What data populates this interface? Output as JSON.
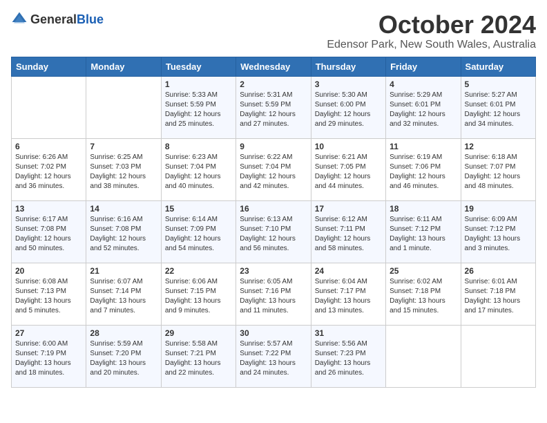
{
  "logo": {
    "general": "General",
    "blue": "Blue"
  },
  "header": {
    "month": "October 2024",
    "location": "Edensor Park, New South Wales, Australia"
  },
  "days_of_week": [
    "Sunday",
    "Monday",
    "Tuesday",
    "Wednesday",
    "Thursday",
    "Friday",
    "Saturday"
  ],
  "weeks": [
    [
      {
        "day": null
      },
      {
        "day": null
      },
      {
        "day": "1",
        "sunrise": "Sunrise: 5:33 AM",
        "sunset": "Sunset: 5:59 PM",
        "daylight": "Daylight: 12 hours and 25 minutes."
      },
      {
        "day": "2",
        "sunrise": "Sunrise: 5:31 AM",
        "sunset": "Sunset: 5:59 PM",
        "daylight": "Daylight: 12 hours and 27 minutes."
      },
      {
        "day": "3",
        "sunrise": "Sunrise: 5:30 AM",
        "sunset": "Sunset: 6:00 PM",
        "daylight": "Daylight: 12 hours and 29 minutes."
      },
      {
        "day": "4",
        "sunrise": "Sunrise: 5:29 AM",
        "sunset": "Sunset: 6:01 PM",
        "daylight": "Daylight: 12 hours and 32 minutes."
      },
      {
        "day": "5",
        "sunrise": "Sunrise: 5:27 AM",
        "sunset": "Sunset: 6:01 PM",
        "daylight": "Daylight: 12 hours and 34 minutes."
      }
    ],
    [
      {
        "day": "6",
        "sunrise": "Sunrise: 6:26 AM",
        "sunset": "Sunset: 7:02 PM",
        "daylight": "Daylight: 12 hours and 36 minutes."
      },
      {
        "day": "7",
        "sunrise": "Sunrise: 6:25 AM",
        "sunset": "Sunset: 7:03 PM",
        "daylight": "Daylight: 12 hours and 38 minutes."
      },
      {
        "day": "8",
        "sunrise": "Sunrise: 6:23 AM",
        "sunset": "Sunset: 7:04 PM",
        "daylight": "Daylight: 12 hours and 40 minutes."
      },
      {
        "day": "9",
        "sunrise": "Sunrise: 6:22 AM",
        "sunset": "Sunset: 7:04 PM",
        "daylight": "Daylight: 12 hours and 42 minutes."
      },
      {
        "day": "10",
        "sunrise": "Sunrise: 6:21 AM",
        "sunset": "Sunset: 7:05 PM",
        "daylight": "Daylight: 12 hours and 44 minutes."
      },
      {
        "day": "11",
        "sunrise": "Sunrise: 6:19 AM",
        "sunset": "Sunset: 7:06 PM",
        "daylight": "Daylight: 12 hours and 46 minutes."
      },
      {
        "day": "12",
        "sunrise": "Sunrise: 6:18 AM",
        "sunset": "Sunset: 7:07 PM",
        "daylight": "Daylight: 12 hours and 48 minutes."
      }
    ],
    [
      {
        "day": "13",
        "sunrise": "Sunrise: 6:17 AM",
        "sunset": "Sunset: 7:08 PM",
        "daylight": "Daylight: 12 hours and 50 minutes."
      },
      {
        "day": "14",
        "sunrise": "Sunrise: 6:16 AM",
        "sunset": "Sunset: 7:08 PM",
        "daylight": "Daylight: 12 hours and 52 minutes."
      },
      {
        "day": "15",
        "sunrise": "Sunrise: 6:14 AM",
        "sunset": "Sunset: 7:09 PM",
        "daylight": "Daylight: 12 hours and 54 minutes."
      },
      {
        "day": "16",
        "sunrise": "Sunrise: 6:13 AM",
        "sunset": "Sunset: 7:10 PM",
        "daylight": "Daylight: 12 hours and 56 minutes."
      },
      {
        "day": "17",
        "sunrise": "Sunrise: 6:12 AM",
        "sunset": "Sunset: 7:11 PM",
        "daylight": "Daylight: 12 hours and 58 minutes."
      },
      {
        "day": "18",
        "sunrise": "Sunrise: 6:11 AM",
        "sunset": "Sunset: 7:12 PM",
        "daylight": "Daylight: 13 hours and 1 minute."
      },
      {
        "day": "19",
        "sunrise": "Sunrise: 6:09 AM",
        "sunset": "Sunset: 7:12 PM",
        "daylight": "Daylight: 13 hours and 3 minutes."
      }
    ],
    [
      {
        "day": "20",
        "sunrise": "Sunrise: 6:08 AM",
        "sunset": "Sunset: 7:13 PM",
        "daylight": "Daylight: 13 hours and 5 minutes."
      },
      {
        "day": "21",
        "sunrise": "Sunrise: 6:07 AM",
        "sunset": "Sunset: 7:14 PM",
        "daylight": "Daylight: 13 hours and 7 minutes."
      },
      {
        "day": "22",
        "sunrise": "Sunrise: 6:06 AM",
        "sunset": "Sunset: 7:15 PM",
        "daylight": "Daylight: 13 hours and 9 minutes."
      },
      {
        "day": "23",
        "sunrise": "Sunrise: 6:05 AM",
        "sunset": "Sunset: 7:16 PM",
        "daylight": "Daylight: 13 hours and 11 minutes."
      },
      {
        "day": "24",
        "sunrise": "Sunrise: 6:04 AM",
        "sunset": "Sunset: 7:17 PM",
        "daylight": "Daylight: 13 hours and 13 minutes."
      },
      {
        "day": "25",
        "sunrise": "Sunrise: 6:02 AM",
        "sunset": "Sunset: 7:18 PM",
        "daylight": "Daylight: 13 hours and 15 minutes."
      },
      {
        "day": "26",
        "sunrise": "Sunrise: 6:01 AM",
        "sunset": "Sunset: 7:18 PM",
        "daylight": "Daylight: 13 hours and 17 minutes."
      }
    ],
    [
      {
        "day": "27",
        "sunrise": "Sunrise: 6:00 AM",
        "sunset": "Sunset: 7:19 PM",
        "daylight": "Daylight: 13 hours and 18 minutes."
      },
      {
        "day": "28",
        "sunrise": "Sunrise: 5:59 AM",
        "sunset": "Sunset: 7:20 PM",
        "daylight": "Daylight: 13 hours and 20 minutes."
      },
      {
        "day": "29",
        "sunrise": "Sunrise: 5:58 AM",
        "sunset": "Sunset: 7:21 PM",
        "daylight": "Daylight: 13 hours and 22 minutes."
      },
      {
        "day": "30",
        "sunrise": "Sunrise: 5:57 AM",
        "sunset": "Sunset: 7:22 PM",
        "daylight": "Daylight: 13 hours and 24 minutes."
      },
      {
        "day": "31",
        "sunrise": "Sunrise: 5:56 AM",
        "sunset": "Sunset: 7:23 PM",
        "daylight": "Daylight: 13 hours and 26 minutes."
      },
      {
        "day": null
      },
      {
        "day": null
      }
    ]
  ]
}
